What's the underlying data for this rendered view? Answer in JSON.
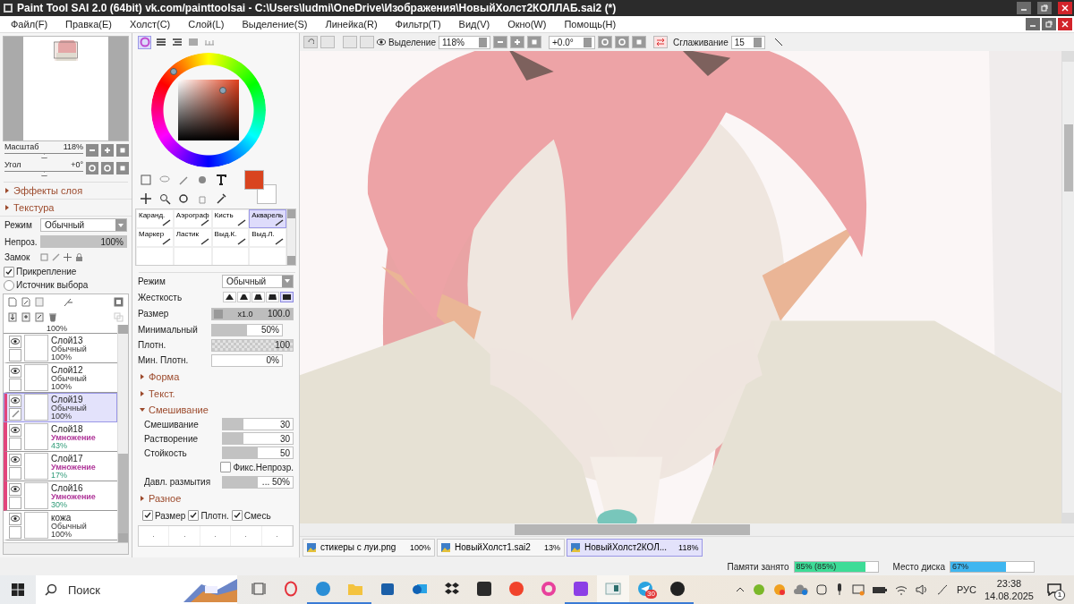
{
  "window": {
    "title": "Paint Tool SAI 2.0 (64bit) vk.com/painttoolsai - C:\\Users\\ludmi\\OneDrive\\Изображения\\НовыйХолст2КОЛЛАБ.sai2 (*)"
  },
  "menu": [
    {
      "label": "Файл(F)"
    },
    {
      "label": "Правка(E)"
    },
    {
      "label": "Холст(C)"
    },
    {
      "label": "Слой(L)"
    },
    {
      "label": "Выделение(S)"
    },
    {
      "label": "Линейка(R)"
    },
    {
      "label": "Фильтр(T)"
    },
    {
      "label": "Вид(V)"
    },
    {
      "label": "Окно(W)"
    },
    {
      "label": "Помощь(H)"
    }
  ],
  "navigator": {
    "zoom": {
      "label": "Масштаб",
      "value": "118%",
      "level": 0.5
    },
    "angle": {
      "label": "Угол",
      "value": "+0°",
      "level": 0.5
    }
  },
  "left_sections": [
    {
      "label": "Эффекты слоя",
      "expanded": false
    },
    {
      "label": "Текстура",
      "expanded": false
    }
  ],
  "layer_props": {
    "mode": {
      "label": "Режим",
      "value": "Обычный"
    },
    "opacity": {
      "label": "Непроз.",
      "value": "100%",
      "level": 1
    },
    "lock_label": "Замок",
    "options": [
      {
        "kind": "check",
        "label": "Прикрепление",
        "checked": true
      },
      {
        "kind": "radio",
        "label": "Источник выбора",
        "checked": false
      }
    ]
  },
  "layers": [
    {
      "kind": "cut",
      "opacity": "100%"
    },
    {
      "kind": "layer",
      "name": "Слой13",
      "mode": "Обычный",
      "opacity": "100%",
      "visible": true,
      "clipped": false,
      "selected": false
    },
    {
      "kind": "layer",
      "name": "Слой12",
      "mode": "Обычный",
      "opacity": "100%",
      "visible": true,
      "clipped": false,
      "selected": false
    },
    {
      "kind": "layer",
      "name": "Слой19",
      "mode": "Обычный",
      "opacity": "100%",
      "visible": true,
      "clipped": true,
      "selected": true
    },
    {
      "kind": "layer",
      "name": "Слой18",
      "mode": "Умножение",
      "opacity": "43%",
      "visible": true,
      "clipped": true,
      "selected": false,
      "color": "#b0389a"
    },
    {
      "kind": "layer",
      "name": "Слой17",
      "mode": "Умножение",
      "opacity": "17%",
      "visible": true,
      "clipped": true,
      "selected": false,
      "color": "#b0389a"
    },
    {
      "kind": "layer",
      "name": "Слой16",
      "mode": "Умножение",
      "opacity": "30%",
      "visible": true,
      "clipped": true,
      "selected": false,
      "color": "#b0389a"
    },
    {
      "kind": "layer",
      "name": "кожа",
      "mode": "Обычный",
      "opacity": "100%",
      "visible": true,
      "clipped": false,
      "selected": false
    }
  ],
  "color_panel": {
    "tabs": [
      {
        "kind": "wheel",
        "selected": true
      },
      {
        "kind": "rgb",
        "selected": false
      },
      {
        "kind": "hsv",
        "selected": false
      },
      {
        "kind": "swatches",
        "selected": false
      },
      {
        "kind": "scratch",
        "selected": false
      }
    ],
    "swatches": [
      {
        "kind": "primary",
        "color": "#d9441f"
      },
      {
        "kind": "secondary",
        "color": "#ffffff"
      }
    ]
  },
  "brushes": [
    {
      "name": "Каранд.",
      "selected": false
    },
    {
      "name": "Аэрограф",
      "selected": false
    },
    {
      "name": "Кисть",
      "selected": false
    },
    {
      "name": "Акварель",
      "selected": true
    },
    {
      "name": "Маркер",
      "selected": false
    },
    {
      "name": "Ластик",
      "selected": false
    },
    {
      "name": "Выд.К.",
      "selected": false
    },
    {
      "name": "Выд.Л.",
      "selected": false
    }
  ],
  "brush_settings": {
    "mode": {
      "label": "Режим",
      "value": "Обычный"
    },
    "hardness": {
      "label": "Жесткость",
      "shapes": [
        {
          "selected": false
        },
        {
          "selected": false
        },
        {
          "selected": false
        },
        {
          "selected": false
        },
        {
          "selected": true
        }
      ]
    },
    "size": {
      "label": "Размер",
      "multiplier": "x1.0",
      "value": "100.0",
      "level": 1
    },
    "sliders": [
      {
        "label": "Минимальный",
        "value": "50%",
        "level": 0.5,
        "kind": "plain"
      },
      {
        "label": "Плотн.",
        "value": "100",
        "level": 1,
        "kind": "checker"
      },
      {
        "label": "Мин. Плотн.",
        "value": "0%",
        "level": 0,
        "kind": "plain"
      }
    ],
    "sections": [
      {
        "label": "Форма",
        "expanded": false
      },
      {
        "label": "Текст.",
        "expanded": false
      }
    ],
    "blending": {
      "label": "Смешивание",
      "expanded": true,
      "sliders": [
        {
          "label": "Смешивание",
          "value": "30",
          "level": 0.3
        },
        {
          "label": "Растворение",
          "value": "30",
          "level": 0.3
        },
        {
          "label": "Стойкость",
          "value": "50",
          "level": 0.5
        }
      ],
      "fix_opacity": {
        "label": "Фикс.Непрозр.",
        "checked": false
      },
      "blur_pressure": {
        "label": "Давл. размытия",
        "value": "... 50%",
        "level": 0.5
      }
    },
    "misc": {
      "label": "Разное",
      "expanded": false
    },
    "pressure_checks": [
      {
        "label": "Размер",
        "checked": true
      },
      {
        "label": "Плотн.",
        "checked": true
      },
      {
        "label": "Смесь",
        "checked": true
      }
    ]
  },
  "canvas_toolbar": {
    "selection_label": "Выделение",
    "zoom": "118%",
    "angle": "+0.0°",
    "smoothing_label": "Сглаживание",
    "smoothing": "15"
  },
  "documents": [
    {
      "name": "стикеры с луи.png",
      "zoom": "100%",
      "selected": false
    },
    {
      "name": "НовыйХолст1.sai2",
      "zoom": "13%",
      "selected": false
    },
    {
      "name": "НовыйХолст2КОЛ...",
      "zoom": "118%",
      "selected": true
    }
  ],
  "status_meters": [
    {
      "label": "Памяти занято",
      "value": "85% (85%)",
      "level": 0.85,
      "color": "#3ddc97"
    },
    {
      "label": "Место диска",
      "value": "67%",
      "level": 0.67,
      "color": "#3fb6f0"
    }
  ],
  "taskbar": {
    "search": {
      "placeholder": "Поиск"
    },
    "apps": [
      {
        "kind": "taskview",
        "running": false,
        "active": false
      },
      {
        "kind": "ring",
        "running": false,
        "active": false
      },
      {
        "kind": "browser",
        "running": true,
        "active": false
      },
      {
        "kind": "folder",
        "running": true,
        "active": false
      },
      {
        "kind": "store",
        "running": false,
        "active": false
      },
      {
        "kind": "mail",
        "running": false,
        "active": false
      },
      {
        "kind": "boxes",
        "running": false,
        "active": false
      },
      {
        "kind": "square",
        "running": false,
        "active": false
      },
      {
        "kind": "redcircle",
        "running": false,
        "active": false
      },
      {
        "kind": "rainbow",
        "running": false,
        "active": false
      },
      {
        "kind": "purple",
        "running": true,
        "active": false
      },
      {
        "kind": "window",
        "running": true,
        "active": true
      },
      {
        "kind": "plane",
        "running": true,
        "active": false,
        "badge": "30"
      },
      {
        "kind": "record",
        "running": true,
        "active": false
      }
    ],
    "language": "РУС",
    "time": "23:38",
    "date": "14.08.2025",
    "notifications": "1"
  }
}
